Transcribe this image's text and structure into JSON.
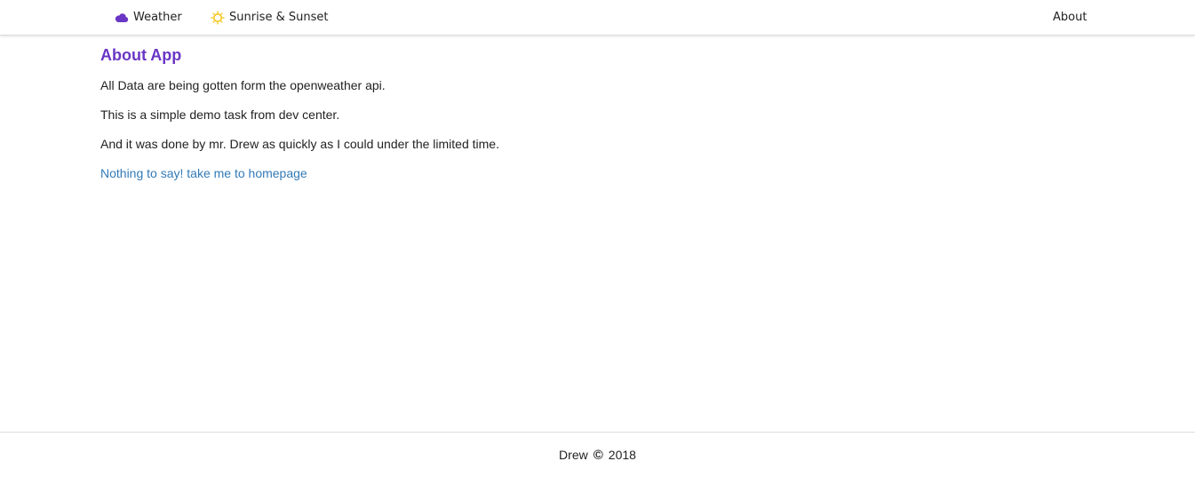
{
  "navbar": {
    "weather_label": "Weather",
    "sunrise_label": "Sunrise & Sunset",
    "about_label": "About",
    "weather_icon": "cloud-icon",
    "sunrise_icon": "sun-icon"
  },
  "main": {
    "title": "About App",
    "paragraphs": [
      "All Data are being gotten form the openweather api.",
      "This is a simple demo task from dev center.",
      "And it was done by mr. Drew as quickly as I could under the limited time."
    ],
    "home_link": "Nothing to say! take me to homepage"
  },
  "footer": {
    "author": "Drew",
    "copyright_symbol": "©",
    "year": "2018"
  },
  "colors": {
    "accent": "#6a36c5",
    "link": "#337ab7",
    "sun": "#f5c518"
  }
}
